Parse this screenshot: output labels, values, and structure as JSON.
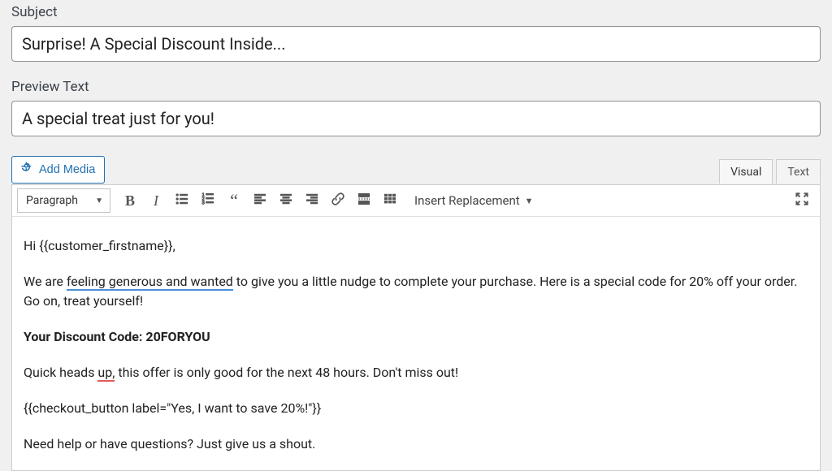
{
  "fields": {
    "subject_label": "Subject",
    "subject_value": "Surprise! A Special Discount Inside...",
    "preview_label": "Preview Text",
    "preview_value": "A special treat just for you!"
  },
  "buttons": {
    "add_media": "Add Media"
  },
  "tabs": {
    "visual": "Visual",
    "text": "Text"
  },
  "toolbar": {
    "format": "Paragraph",
    "insert_replacement": "Insert Replacement"
  },
  "body": {
    "p1_pre": "Hi ",
    "p1_var": "{{customer_firstname}}",
    "p1_post": ",",
    "p2_pre": "We are ",
    "p2_spell": "feeling generous and wanted",
    "p2_post": " to give you a little nudge to complete your purchase. Here is a special code for 20% off your order. Go on, treat yourself!",
    "p3": "Your Discount Code: 20FORYOU",
    "p4_pre": "Quick heads ",
    "p4_spell": "up,",
    "p4_post": " this offer is only good for the next 48 hours. Don't miss out!",
    "p5": "{{checkout_button label=\"Yes, I want to save 20%!\"}}",
    "p6": "Need help or have questions? Just give us a shout."
  }
}
